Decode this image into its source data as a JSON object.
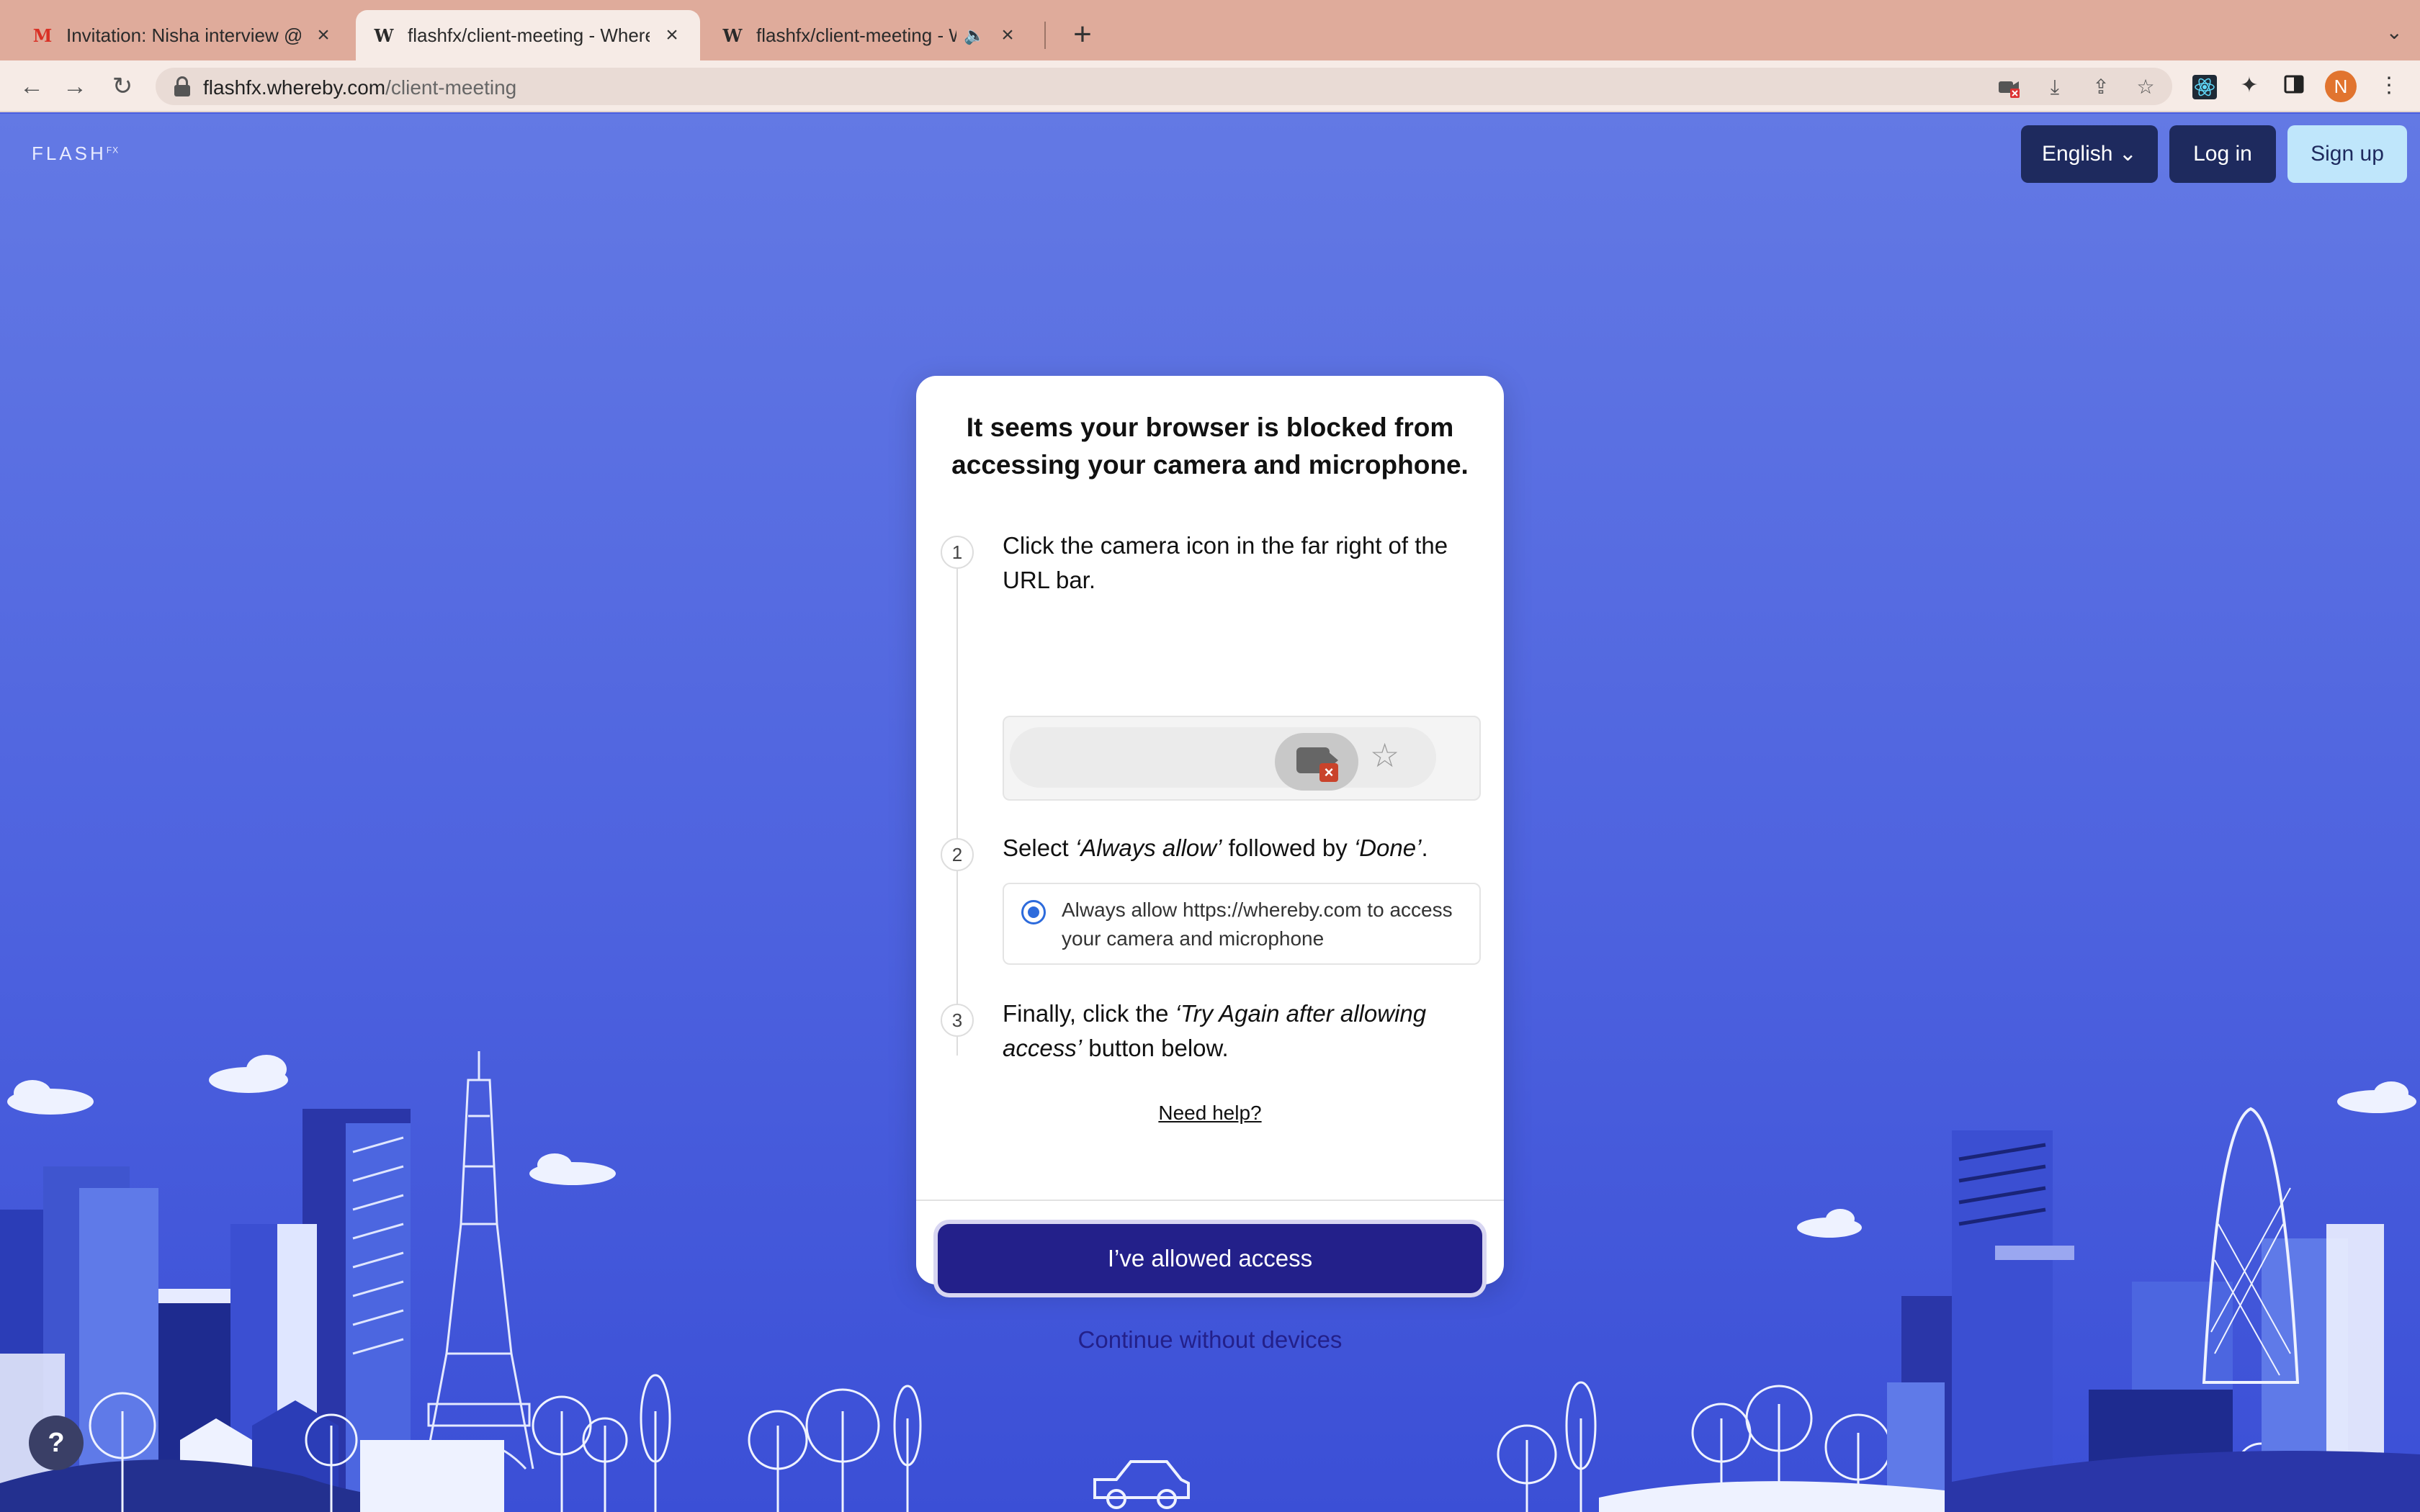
{
  "browser": {
    "tabs": [
      {
        "title": "Invitation: Nisha interview @ W",
        "favicon": "gmail-icon",
        "active": false
      },
      {
        "title": "flashfx/client-meeting - Where",
        "favicon": "whereby-icon",
        "active": true
      },
      {
        "title": "flashfx/client-meeting - Wi",
        "favicon": "whereby-icon",
        "active": false,
        "audio": true
      }
    ],
    "url_host": "flashfx.whereby.com",
    "url_path": "/client-meeting",
    "profile_initial": "N"
  },
  "header": {
    "logo_text": "FLASH",
    "logo_sup": "FX",
    "language_label": "English",
    "login_label": "Log in",
    "signup_label": "Sign up"
  },
  "modal": {
    "title": "It seems your browser is blocked from accessing your camera and microphone.",
    "steps": [
      {
        "number": "1",
        "text": "Click the camera icon in the far right of the URL bar."
      },
      {
        "number": "2",
        "text_prefix": "Select ",
        "text_em1": "‘Always allow’",
        "text_mid": " followed by ",
        "text_em2": "‘Done’",
        "text_suffix": "."
      },
      {
        "number": "3",
        "text_prefix": "Finally, click the ",
        "text_em": "‘Try Again after allowing access’",
        "text_suffix": " button below."
      }
    ],
    "radio_label": "Always allow https://whereby.com to access your camera and microphone",
    "need_help": "Need help?",
    "primary_button": "I’ve allowed access",
    "secondary_link": "Continue without devices"
  },
  "help_button": "?",
  "colors": {
    "page_background": "#4e63df",
    "primary_button": "#23208a",
    "header_dark": "#1e2a5e",
    "signup_bg": "#bfe6fb"
  }
}
